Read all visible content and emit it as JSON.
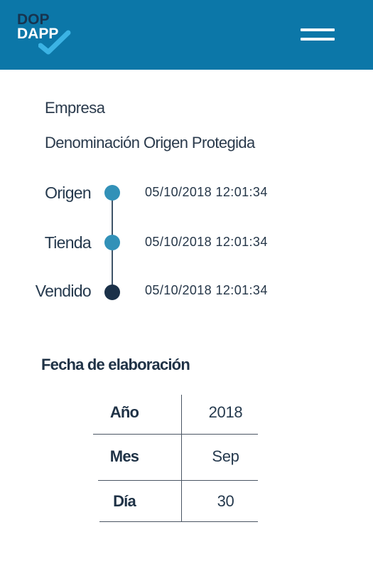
{
  "app": {
    "logo_line1": "DOP",
    "logo_line2": "DAPP",
    "colors": {
      "header": "#0c77a8",
      "logo_dark": "#17344f",
      "check": "#3bb3e4",
      "dot_light": "#3291b8",
      "dot_dark": "#1b3149"
    }
  },
  "header": {
    "menu_icon": "hamburger-menu-icon"
  },
  "info": {
    "empresa": "Empresa",
    "denominacion": "Denominación Origen Protegida"
  },
  "timeline": [
    {
      "label": "Origen",
      "date": "05/10/2018 12:01:34",
      "status": "light"
    },
    {
      "label": "Tienda",
      "date": "05/10/2018 12:01:34",
      "status": "light"
    },
    {
      "label": "Vendido",
      "date": "05/10/2018 12:01:34",
      "status": "dark"
    }
  ],
  "fecha": {
    "title": "Fecha de elaboración",
    "rows": [
      {
        "key": "Año",
        "value": "2018"
      },
      {
        "key": "Mes",
        "value": "Sep"
      },
      {
        "key": "Día",
        "value": "30"
      }
    ]
  }
}
